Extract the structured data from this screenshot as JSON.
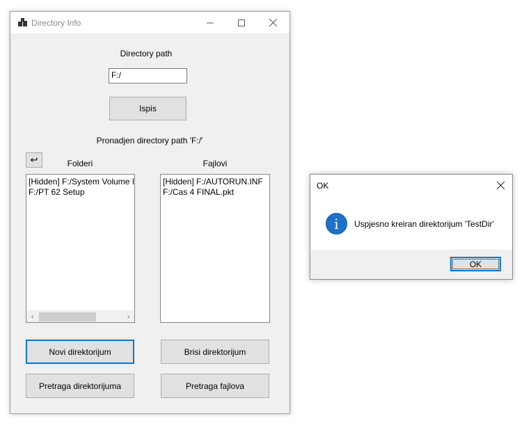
{
  "main_window": {
    "title": "Directory Info",
    "directory_path_label": "Directory path",
    "path_input_value": "F:/",
    "ispis_button": "Ispis",
    "found_path_label": "Pronadjen directory path 'F:/'",
    "back_button": "↩",
    "folders_label": "Folderi",
    "files_label": "Fajlovi",
    "folders": [
      "[Hidden] F:/System Volume Information",
      "F:/PT 62 Setup"
    ],
    "files": [
      "[Hidden] F:/AUTORUN.INF",
      "F:/Cas 4 FINAL.pkt"
    ],
    "buttons": {
      "new_dir": "Novi direktorijum",
      "delete_dir": "Brisi direktorijum",
      "search_dirs": "Pretraga direktorijuma",
      "search_files": "Pretraga fajlova"
    },
    "scroll_left": "‹",
    "scroll_right": "›"
  },
  "dialog": {
    "title": "OK",
    "message": "Uspjesno kreiran direktorijum 'TestDir'",
    "ok_button": "OK",
    "icon": "information-icon"
  },
  "colors": {
    "window_bg": "#f0f0f0",
    "accent": "#0078d7",
    "info_blue": "#1e73c8"
  }
}
